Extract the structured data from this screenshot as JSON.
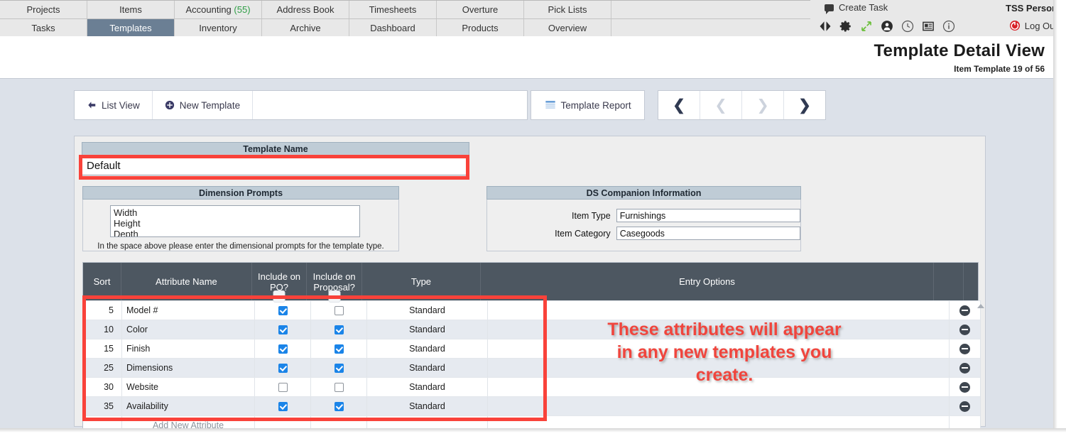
{
  "navbar": {
    "row1": [
      {
        "label": "Projects",
        "badge": "",
        "active": false
      },
      {
        "label": "Items",
        "badge": "",
        "active": false
      },
      {
        "label": "Accounting",
        "badge": "(55)",
        "active": false
      },
      {
        "label": "Address Book",
        "badge": "",
        "active": false
      },
      {
        "label": "Timesheets",
        "badge": "",
        "active": false
      },
      {
        "label": "Overture",
        "badge": "",
        "active": false
      },
      {
        "label": "Pick Lists",
        "badge": "",
        "active": false
      }
    ],
    "row2": [
      {
        "label": "Tasks",
        "badge": "",
        "active": false
      },
      {
        "label": "Templates",
        "badge": "",
        "active": true
      },
      {
        "label": "Inventory",
        "badge": "",
        "active": false
      },
      {
        "label": "Archive",
        "badge": "",
        "active": false
      },
      {
        "label": "Dashboard",
        "badge": "",
        "active": false
      },
      {
        "label": "Products",
        "badge": "",
        "active": false
      },
      {
        "label": "Overview",
        "badge": "",
        "active": false
      }
    ],
    "create_task": "Create Task",
    "user_name": "TSS Person",
    "log_out": "Log Out",
    "icons": [
      "prev-next-arrows-icon",
      "gear-icon",
      "expand-icon",
      "user-icon",
      "clock-icon",
      "news-icon",
      "info-icon"
    ],
    "accent_green": "#2e9e45",
    "accent_red": "#d81f26",
    "active_tab_color": "#6b7f94"
  },
  "header": {
    "title": "Template Detail View",
    "subtitle": "Item Template 19 of 56"
  },
  "toolbar": {
    "list_view": "List View",
    "new_template": "New Template",
    "template_report": "Template Report",
    "nav": {
      "first": "❮",
      "prev": "❮",
      "next": "❯",
      "last": "❯"
    }
  },
  "template_name": {
    "header": "Template Name",
    "value": "Default",
    "placeholder": "Template Name"
  },
  "dimension_prompts": {
    "header": "Dimension Prompts",
    "value": "Width\nHeight\nDepth",
    "note": "In the space above please enter the dimensional prompts for the template type."
  },
  "ds_companion": {
    "header": "DS Companion Information",
    "fields": [
      {
        "label": "Item Type",
        "value": "Furnishings"
      },
      {
        "label": "Item Category",
        "value": "Casegoods"
      }
    ]
  },
  "attribute_grid": {
    "columns": [
      "Sort",
      "Attribute Name",
      "Include on PO?",
      "Include on Proposal?",
      "Type",
      "Entry Options",
      "",
      ""
    ],
    "rows": [
      {
        "sort": "5",
        "name": "Model #",
        "po": true,
        "proposal": false,
        "type": "Standard",
        "entry": ""
      },
      {
        "sort": "10",
        "name": "Color",
        "po": true,
        "proposal": true,
        "type": "Standard",
        "entry": ""
      },
      {
        "sort": "15",
        "name": "Finish",
        "po": true,
        "proposal": true,
        "type": "Standard",
        "entry": ""
      },
      {
        "sort": "25",
        "name": "Dimensions",
        "po": true,
        "proposal": true,
        "type": "Standard",
        "entry": ""
      },
      {
        "sort": "30",
        "name": "Website",
        "po": false,
        "proposal": false,
        "type": "Standard",
        "entry": ""
      },
      {
        "sort": "35",
        "name": "Availability",
        "po": true,
        "proposal": true,
        "type": "Standard",
        "entry": ""
      }
    ],
    "add_new": "Add New Attribute",
    "header_bg": "#4d5761",
    "checked_color": "#1a84e8"
  },
  "annotation": {
    "text": "These attributes will appear\nin any new templates you\ncreate.",
    "color": "#f0453d",
    "highlight_color": "#f9423a"
  }
}
